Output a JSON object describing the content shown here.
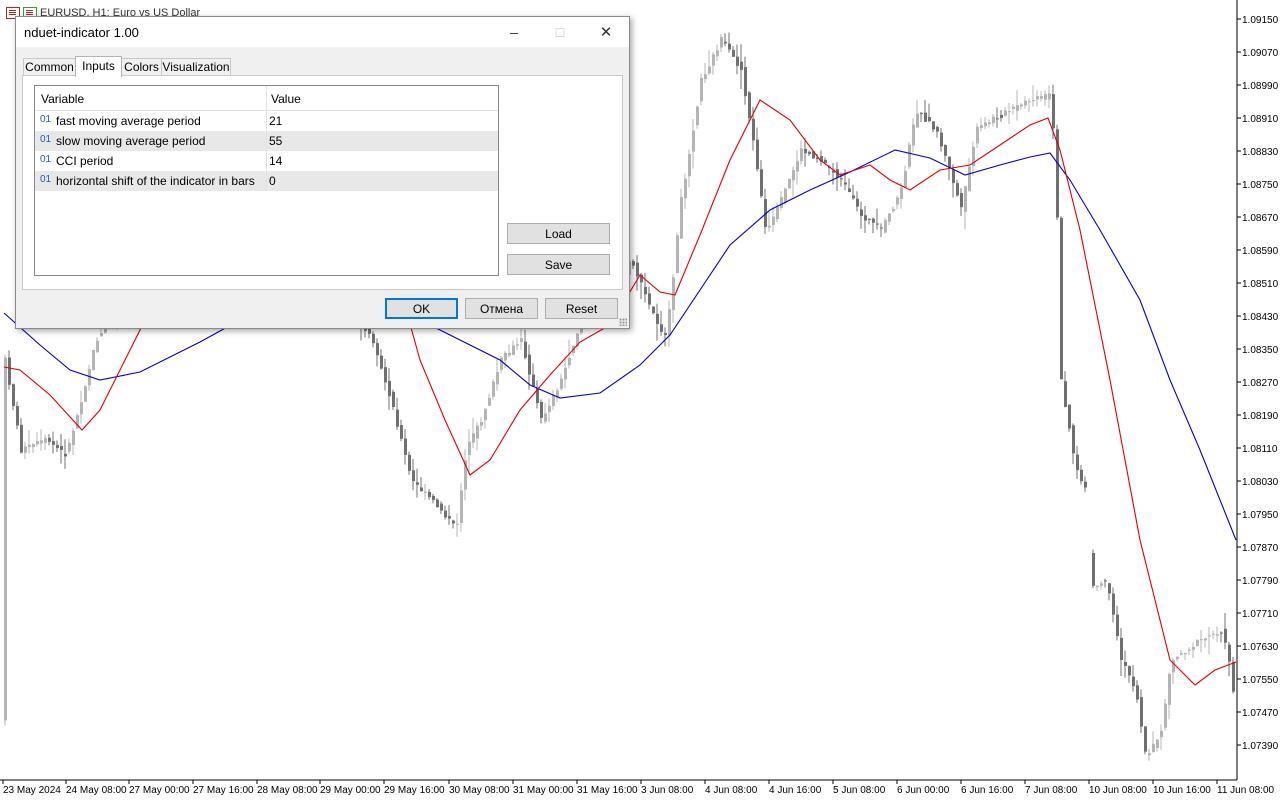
{
  "chart": {
    "title": "EURUSD, H1:  Euro vs US Dollar",
    "price_labels": [
      "1.09150",
      "1.09070",
      "1.08990",
      "1.08910",
      "1.08830",
      "1.08750",
      "1.08670",
      "1.08590",
      "1.08510",
      "1.08430",
      "1.08350",
      "1.08270",
      "1.08190",
      "1.08110",
      "1.08030",
      "1.07950",
      "1.07870",
      "1.07790",
      "1.07710",
      "1.07630",
      "1.07550",
      "1.07470",
      "1.07390"
    ],
    "time_labels": [
      "23 May 2024",
      "24 May 08:00",
      "27 May 00:00",
      "27 May 16:00",
      "28 May 08:00",
      "29 May 00:00",
      "29 May 16:00",
      "30 May 08:00",
      "31 May 00:00",
      "31 May 16:00",
      "3 Jun 08:00",
      "4 Jun 08:00",
      "4 Jun 16:00",
      "5 Jun 08:00",
      "6 Jun 00:00",
      "6 Jun 16:00",
      "7 Jun 08:00",
      "10 Jun 08:00",
      "10 Jun 16:00",
      "11 Jun 08:00"
    ],
    "colors": {
      "fast_ma": "#e00000",
      "slow_ma": "#0000cc",
      "candle_bear": "#707070",
      "candle_bull": "#b4b4b4"
    }
  },
  "dialog": {
    "title": "nduet-indicator 1.00",
    "controls": {
      "minimize": "–",
      "maximize": "□",
      "close": "✕"
    },
    "tabs": [
      {
        "label": "Common"
      },
      {
        "label": "Inputs"
      },
      {
        "label": "Colors"
      },
      {
        "label": "Visualization"
      }
    ],
    "active_tab": "Inputs",
    "grid": {
      "headers": {
        "variable": "Variable",
        "value": "Value"
      },
      "rows": [
        {
          "type": "01",
          "name": "fast moving average period",
          "value": "21"
        },
        {
          "type": "01",
          "name": "slow moving average period",
          "value": "55"
        },
        {
          "type": "01",
          "name": "CCI period",
          "value": "14"
        },
        {
          "type": "01",
          "name": "horizontal shift of the indicator in bars",
          "value": "0"
        }
      ]
    },
    "buttons": {
      "load": "Load",
      "save": "Save",
      "ok": "OK",
      "cancel": "Отмена",
      "reset": "Reset"
    }
  }
}
